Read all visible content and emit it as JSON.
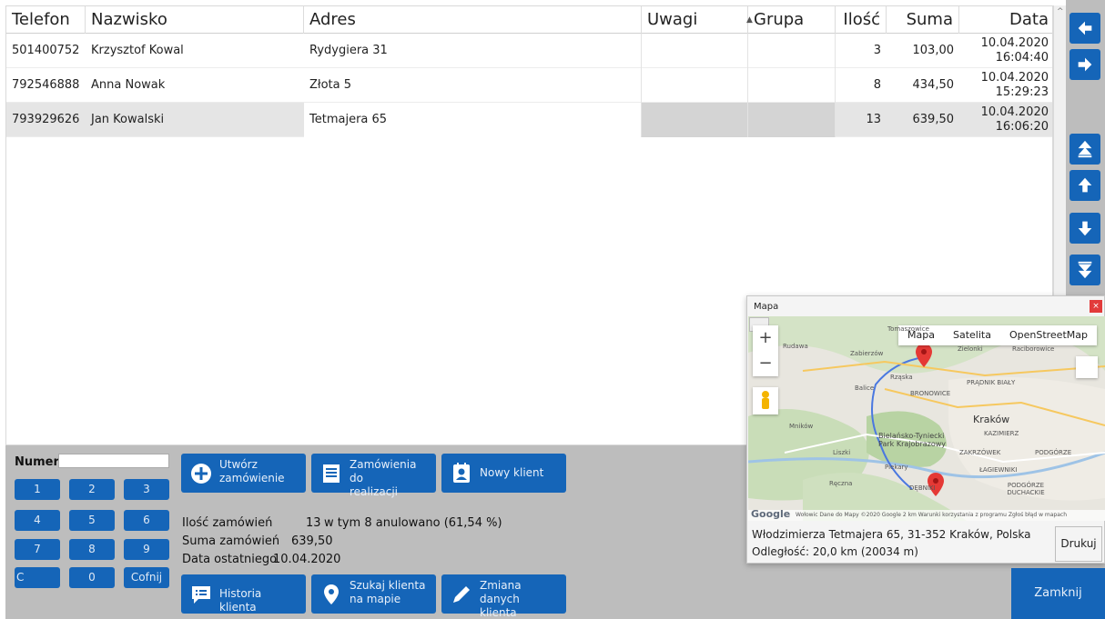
{
  "table": {
    "headers": {
      "telefon": "Telefon",
      "nazwisko": "Nazwisko",
      "adres": "Adres",
      "uwagi": "Uwagi",
      "grupa": "Grupa",
      "ilosc": "Ilość",
      "suma": "Suma",
      "data": "Data"
    },
    "rows": [
      {
        "telefon": "501400752",
        "nazwisko": "Krzysztof Kowal",
        "adres": "Rydygiera 31",
        "uwagi": "",
        "grupa": "",
        "ilosc": "3",
        "suma": "103,00",
        "date": "10.04.2020",
        "time": "16:04:40"
      },
      {
        "telefon": "792546888",
        "nazwisko": "Anna Nowak",
        "adres": "Złota 5",
        "uwagi": "",
        "grupa": "",
        "ilosc": "8",
        "suma": "434,50",
        "date": "10.04.2020",
        "time": "15:29:23"
      },
      {
        "telefon": "793929626",
        "nazwisko": "Jan Kowalski",
        "adres": "Tetmajera 65",
        "uwagi": "",
        "grupa": "",
        "ilosc": "13",
        "suma": "639,50",
        "date": "10.04.2020",
        "time": "16:06:20"
      }
    ]
  },
  "nav_icons": [
    "arrow-left-icon",
    "arrow-right-icon",
    "double-arrow-up-icon",
    "arrow-up-icon",
    "arrow-down-icon",
    "double-arrow-down-icon"
  ],
  "keypad": {
    "numer_label": "Numer",
    "numer_value": "",
    "keys": [
      "1",
      "2",
      "3",
      "4",
      "5",
      "6",
      "7",
      "8",
      "9",
      "C",
      "0",
      "Cofnij"
    ]
  },
  "actions": {
    "utworz_line1": "Utwórz",
    "utworz_line2": "zamówienie",
    "realizacji_line1": "Zamówienia do",
    "realizacji_line2": "realizacji",
    "nowy_klient": "Nowy klient",
    "historia": "Historia klienta",
    "szukaj_line1": "Szukaj klienta",
    "szukaj_line2": "na mapie",
    "zmiana_line1": "Zmiana danych",
    "zmiana_line2": "klienta"
  },
  "stats": {
    "ilosc_label": "Ilość zamówień",
    "ilosc_value": "13",
    "anulowano": "w tym 8 anulowano (61,54 %)",
    "suma_label": "Suma zamówień",
    "suma_value": "639,50",
    "data_label": "Data ostatniego",
    "data_value": "10.04.2020"
  },
  "map_window": {
    "title": "Mapa",
    "close": "×",
    "map_types": [
      "Mapa",
      "Satelita",
      "OpenStreetMap"
    ],
    "labels": {
      "rudawa": "Rudawa",
      "zabierzow": "Zabierzów",
      "rzaska": "Rząska",
      "balice": "Balice",
      "bronowice": "BRONOWICE",
      "pradnik": "PRĄDNIK BIAŁY",
      "krakow": "Kraków",
      "mnikow": "Mników",
      "bielanski": "Bielańsko-Tyniecki",
      "park": "Park Krajobrazowy",
      "liszki": "Liszki",
      "piekary": "Piekary",
      "raczna": "Ręczna",
      "debniki": "DĘBNIKI",
      "zakrzowek": "ZAKRZÓWEK",
      "lagiewniki": "ŁAGIEWNIKI",
      "podgorze": "PODGÓRZE",
      "podgorze_duchackie": "PODGÓRZE DUCHACKIE",
      "zielonki": "Zielonki",
      "raciborowice": "Raciborowice",
      "kazimierz": "KAZIMIERZ",
      "tomaszowice": "Tomaszowice"
    },
    "footer": "Wołowic  Dane do Mapy ©2020 Google   2 km           Warunki korzystania z programu   Zgłoś błąd w mapach",
    "google": "Google",
    "address": "Włodzimierza Tetmajera 65, 31-352 Kraków, Polska",
    "distance": "Odległość: 20,0 km (20034 m)",
    "print": "Drukuj"
  },
  "close_button": "Zamknij",
  "colors": {
    "accent": "#1565b8",
    "panel": "#bdbdbd",
    "selected_row": "#e5e5e5"
  }
}
